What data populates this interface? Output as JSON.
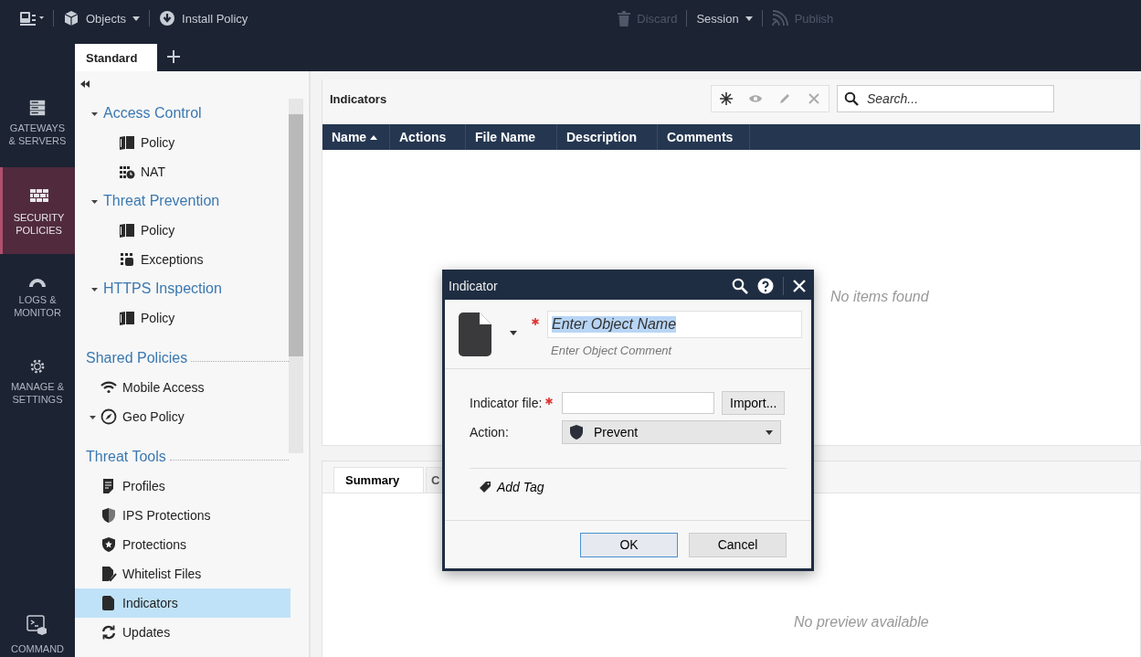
{
  "top_bar": {
    "left": [
      {
        "label": "Objects",
        "has_menu": true,
        "disabled": false
      },
      {
        "label": "Install Policy",
        "has_menu": false,
        "disabled": false
      }
    ],
    "right": [
      {
        "label": "Discard",
        "has_menu": false,
        "disabled": true
      },
      {
        "label": "Session",
        "has_menu": true,
        "disabled": false
      },
      {
        "label": "Publish",
        "has_menu": false,
        "disabled": true
      }
    ]
  },
  "policy_tabs": [
    {
      "label": "Standard",
      "selected": true
    }
  ],
  "nav": [
    {
      "lines": [
        "GATEWAYS",
        "& SERVERS"
      ],
      "selected": false
    },
    {
      "lines": [
        "SECURITY",
        "POLICIES"
      ],
      "selected": true
    },
    {
      "lines": [
        "LOGS &",
        "MONITOR"
      ],
      "selected": false
    },
    {
      "lines": [
        "MANAGE &",
        "SETTINGS"
      ],
      "selected": false
    }
  ],
  "nav_bottom": {
    "label": "COMMAND"
  },
  "tree": [
    {
      "label": "Access Control",
      "expanded": true,
      "children": [
        {
          "label": "Policy"
        },
        {
          "label": "NAT"
        }
      ]
    },
    {
      "label": "Threat Prevention",
      "expanded": true,
      "children": [
        {
          "label": "Policy"
        },
        {
          "label": "Exceptions"
        }
      ]
    },
    {
      "label": "HTTPS Inspection",
      "expanded": true,
      "children": [
        {
          "label": "Policy"
        }
      ]
    }
  ],
  "sections": [
    {
      "title": "Shared Policies",
      "items": [
        {
          "label": "Mobile Access",
          "selected": false
        },
        {
          "label": "Geo Policy",
          "selected": false,
          "expanded": true
        }
      ]
    },
    {
      "title": "Threat Tools",
      "items": [
        {
          "label": "Profiles",
          "selected": false
        },
        {
          "label": "IPS Protections",
          "selected": false
        },
        {
          "label": "Protections",
          "selected": false
        },
        {
          "label": "Whitelist Files",
          "selected": false
        },
        {
          "label": "Indicators",
          "selected": true
        },
        {
          "label": "Updates",
          "selected": false
        }
      ]
    }
  ],
  "content": {
    "title": "Indicators",
    "tools": [
      {
        "kind": "new",
        "disabled": false
      },
      {
        "kind": "view",
        "disabled": true
      },
      {
        "kind": "edit",
        "disabled": true
      },
      {
        "kind": "delete",
        "disabled": true
      }
    ],
    "search": {
      "placeholder": "Search..."
    },
    "table": {
      "columns": [
        {
          "label": "Name",
          "sort_ascending": true
        },
        {
          "label": "Actions"
        },
        {
          "label": "File Name"
        },
        {
          "label": "Description"
        },
        {
          "label": "Comments"
        }
      ],
      "empty_text": "No items found"
    },
    "details": {
      "tabs": [
        {
          "label": "Summary",
          "selected": true
        },
        {
          "label": "C",
          "selected": false
        }
      ],
      "empty_text": "No preview available"
    }
  },
  "dialog": {
    "title": "Indicator",
    "name": {
      "value": "Enter Object Name",
      "required": true,
      "highlighted": true
    },
    "comment": {
      "placeholder": "Enter Object Comment"
    },
    "indicator_file": {
      "label": "Indicator file:",
      "required": true
    },
    "import_button": "Import...",
    "action": {
      "label": "Action:",
      "value": "Prevent"
    },
    "add_tag": "Add Tag",
    "buttons": [
      {
        "label": "OK",
        "default": true
      },
      {
        "label": "Cancel",
        "default": false
      }
    ]
  }
}
